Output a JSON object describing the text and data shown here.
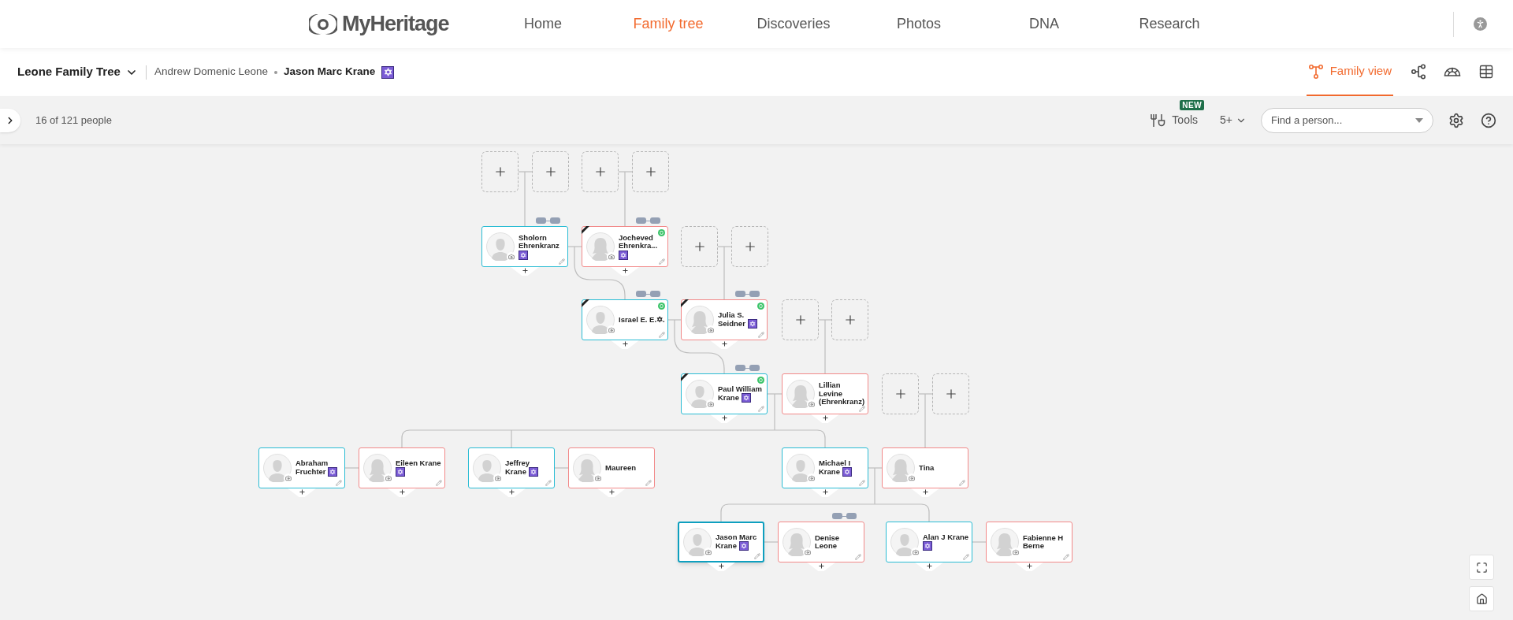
{
  "header": {
    "logo": "MyHeritage",
    "nav": [
      {
        "label": "Home",
        "selected": false
      },
      {
        "label": "Family tree",
        "selected": true
      },
      {
        "label": "Discoveries",
        "selected": false
      },
      {
        "label": "Photos",
        "selected": false
      },
      {
        "label": "DNA",
        "selected": false
      },
      {
        "label": "Research",
        "selected": false
      }
    ]
  },
  "tree_bar": {
    "tree_name": "Leone Family Tree",
    "breadcrumb": [
      "Andrew Domenic Leone",
      "Jason Marc Krane"
    ],
    "current_badge": true,
    "views": [
      {
        "kind": "family",
        "label": "Family view",
        "selected": true
      },
      {
        "kind": "pedigree",
        "selected": false
      },
      {
        "kind": "fan",
        "selected": false
      },
      {
        "kind": "list",
        "selected": false
      }
    ]
  },
  "toolbar": {
    "count": "16 of 121 people",
    "tools": "Tools",
    "tools_badge": "NEW",
    "generations": "5+",
    "search": {
      "placeholder": "Find a person..."
    }
  },
  "persons": [
    {
      "name": "Sholorn Ehrenkranz",
      "kind": "male",
      "badge": true,
      "deceased": false,
      "matches": false,
      "parents_toggle": true,
      "selected": false
    },
    {
      "name": "Jocheved Ehrenkra...",
      "kind": "female",
      "badge": true,
      "deceased": true,
      "matches": true,
      "parents_toggle": true,
      "selected": false
    },
    {
      "name": "Israel E. E.✡.",
      "kind": "male",
      "badge": false,
      "deceased": true,
      "matches": true,
      "parents_toggle": true,
      "selected": false
    },
    {
      "name": "Julia S. Seidner",
      "kind": "female",
      "badge": true,
      "deceased": true,
      "matches": true,
      "parents_toggle": true,
      "selected": false
    },
    {
      "name": "Paul William Krane",
      "kind": "male",
      "badge": true,
      "deceased": true,
      "matches": true,
      "parents_toggle": true,
      "selected": false
    },
    {
      "name": "Lillian Levine (Ehrenkranz)",
      "kind": "female",
      "badge": false,
      "deceased": false,
      "matches": false,
      "parents_toggle": false,
      "selected": false
    },
    {
      "name": "Abraham Fruchter",
      "kind": "male",
      "badge": true,
      "deceased": false,
      "matches": false,
      "parents_toggle": false,
      "selected": false
    },
    {
      "name": "Eileen Krane",
      "kind": "female",
      "badge": true,
      "deceased": false,
      "matches": false,
      "parents_toggle": false,
      "selected": false
    },
    {
      "name": "Jeffrey Krane",
      "kind": "male",
      "badge": true,
      "deceased": false,
      "matches": false,
      "parents_toggle": false,
      "selected": false
    },
    {
      "name": "Maureen",
      "kind": "female",
      "badge": false,
      "deceased": false,
      "matches": false,
      "parents_toggle": false,
      "selected": false
    },
    {
      "name": "Michael I Krane",
      "kind": "male",
      "badge": true,
      "deceased": false,
      "matches": false,
      "parents_toggle": false,
      "selected": false
    },
    {
      "name": "Tina",
      "kind": "female",
      "badge": false,
      "deceased": false,
      "matches": false,
      "parents_toggle": false,
      "selected": false
    },
    {
      "name": "Jason Marc Krane",
      "kind": "male",
      "badge": true,
      "deceased": false,
      "matches": false,
      "parents_toggle": false,
      "selected": true
    },
    {
      "name": "Denise Leone",
      "kind": "female",
      "badge": false,
      "deceased": false,
      "matches": false,
      "parents_toggle": true,
      "selected": false
    },
    {
      "name": "Alan J Krane",
      "kind": "male",
      "badge": true,
      "deceased": false,
      "matches": false,
      "parents_toggle": false,
      "selected": false
    },
    {
      "name": "Fabienne H Berne",
      "kind": "female",
      "badge": false,
      "deceased": false,
      "matches": false,
      "parents_toggle": false,
      "selected": false
    }
  ]
}
